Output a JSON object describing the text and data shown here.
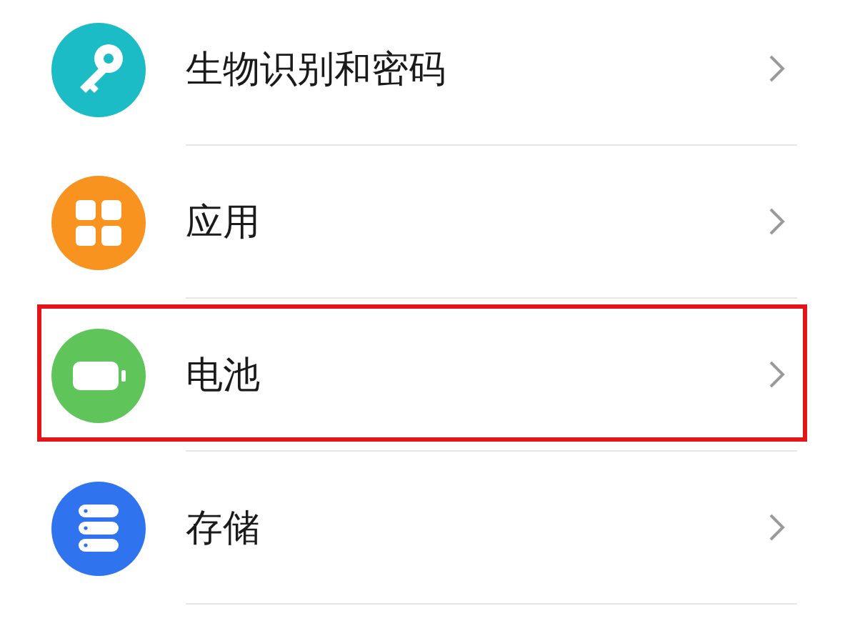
{
  "settings_items": [
    {
      "label": "生物识别和密码",
      "kind": "key",
      "color": "#1bbcc6",
      "highlighted": false
    },
    {
      "label": "应用",
      "kind": "grid",
      "color": "#f7931e",
      "highlighted": false
    },
    {
      "label": "电池",
      "kind": "battery",
      "color": "#5fc45a",
      "highlighted": true
    },
    {
      "label": "存储",
      "kind": "storage",
      "color": "#2f74ee",
      "highlighted": false
    }
  ]
}
